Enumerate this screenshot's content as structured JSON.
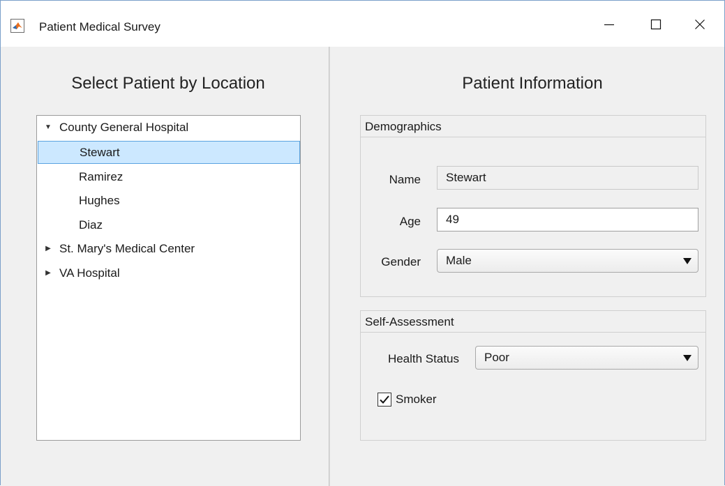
{
  "window": {
    "title": "Patient Medical Survey"
  },
  "left_panel": {
    "title": "Select Patient by Location",
    "tree": [
      {
        "label": "County General Hospital",
        "expanded": true,
        "children": [
          "Stewart",
          "Ramirez",
          "Hughes",
          "Diaz"
        ]
      },
      {
        "label": "St. Mary's Medical Center",
        "expanded": false
      },
      {
        "label": "VA Hospital",
        "expanded": false
      }
    ],
    "selected": "Stewart"
  },
  "right_panel": {
    "title": "Patient Information",
    "demographics": {
      "header": "Demographics",
      "name_label": "Name",
      "name_value": "Stewart",
      "age_label": "Age",
      "age_value": "49",
      "gender_label": "Gender",
      "gender_value": "Male"
    },
    "self_assessment": {
      "header": "Self-Assessment",
      "health_label": "Health Status",
      "health_value": "Poor",
      "smoker_label": "Smoker",
      "smoker_checked": true
    }
  },
  "icons": {
    "app": "matlab-icon",
    "minimize": "minimize-icon",
    "maximize": "maximize-icon",
    "close": "close-icon",
    "expanded": "triangle-down-icon",
    "collapsed": "triangle-right-icon",
    "dropdown": "chevron-down-icon",
    "check": "checkmark-icon"
  },
  "colors": {
    "selection": "#cce8ff",
    "selection_border": "#5aa3e0",
    "window_bg": "#f0f0f0",
    "window_border": "#7a9fc9"
  }
}
